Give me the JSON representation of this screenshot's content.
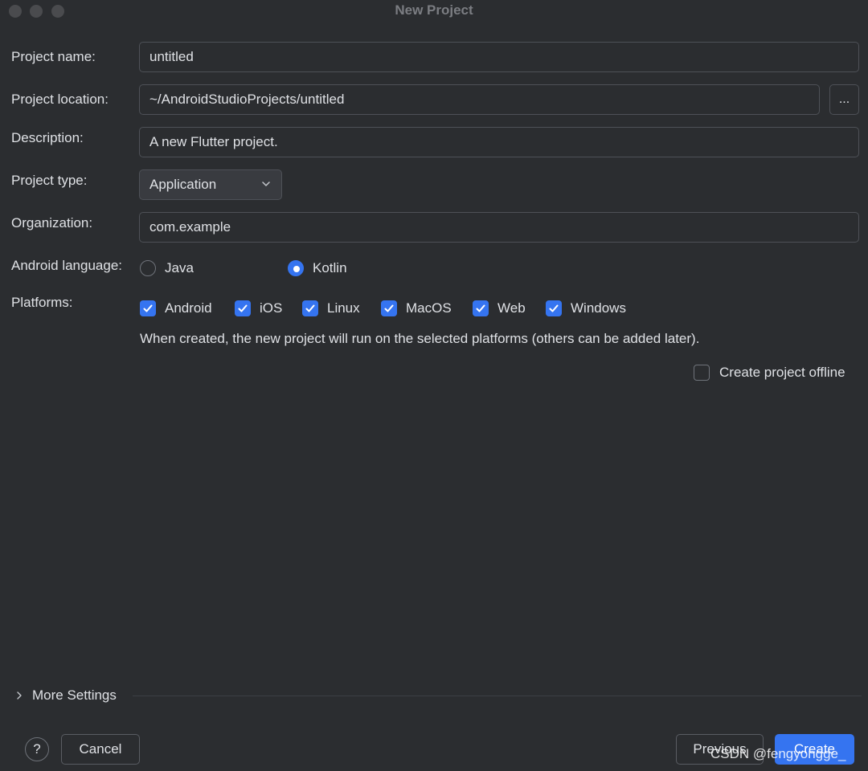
{
  "window": {
    "title": "New Project"
  },
  "form": {
    "project_name": {
      "label": "Project name:",
      "value": "untitled"
    },
    "project_location": {
      "label": "Project location:",
      "value": "~/AndroidStudioProjects/untitled",
      "browse_label": "..."
    },
    "description": {
      "label": "Description:",
      "value": "A new Flutter project."
    },
    "project_type": {
      "label": "Project type:",
      "value": "Application"
    },
    "organization": {
      "label": "Organization:",
      "value": "com.example"
    },
    "android_language": {
      "label": "Android language:",
      "options": [
        {
          "label": "Java",
          "selected": false
        },
        {
          "label": "Kotlin",
          "selected": true
        }
      ]
    },
    "platforms": {
      "label": "Platforms:",
      "options": [
        {
          "label": "Android",
          "checked": true
        },
        {
          "label": "iOS",
          "checked": true
        },
        {
          "label": "Linux",
          "checked": true
        },
        {
          "label": "MacOS",
          "checked": true
        },
        {
          "label": "Web",
          "checked": true
        },
        {
          "label": "Windows",
          "checked": true
        }
      ],
      "hint": "When created, the new project will run on the selected platforms (others can be added later)."
    },
    "offline": {
      "label": "Create project offline",
      "checked": false
    }
  },
  "more_settings": {
    "label": "More Settings"
  },
  "footer": {
    "help_label": "?",
    "cancel_label": "Cancel",
    "previous_label": "Previous",
    "create_label": "Create"
  },
  "watermark": "CSDN @fengyongge_",
  "colors": {
    "background": "#2b2d30",
    "accent": "#3574f0",
    "text": "#dfe1e5",
    "border": "#4e5157"
  }
}
